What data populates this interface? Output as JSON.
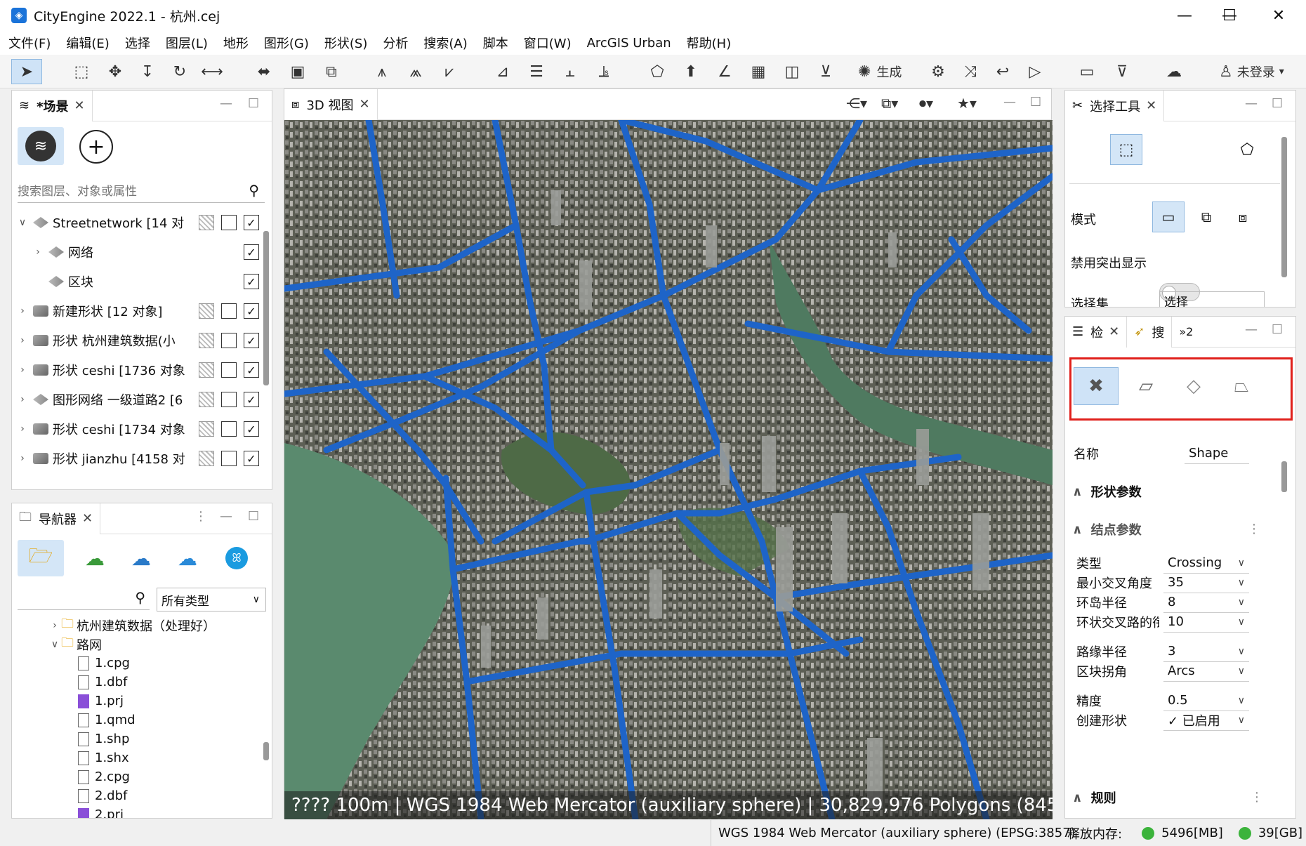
{
  "window": {
    "title": "CityEngine 2022.1 - 杭州.cej",
    "minimize": "—",
    "maximize": "☐",
    "close": "✕"
  },
  "menu": [
    "文件(F)",
    "编辑(E)",
    "选择",
    "图层(L)",
    "地形",
    "图形(G)",
    "形状(S)",
    "分析",
    "搜索(A)",
    "脚本",
    "窗口(W)",
    "ArcGIS Urban",
    "帮助(H)"
  ],
  "toolbar": {
    "generate_label": "生成",
    "login_label": "未登录",
    "login_caret": "▾"
  },
  "scene_panel": {
    "tab_label": "*场景",
    "search_placeholder": "搜索图层、对象或属性",
    "layers": [
      {
        "caret": "∨",
        "name": "Streetnetwork [14 对",
        "hatch": true,
        "box": true,
        "checked": true
      },
      {
        "caret": "›",
        "name": "网络",
        "hatch": false,
        "box": false,
        "checked": true
      },
      {
        "caret": "",
        "name": "区块",
        "hatch": false,
        "box": false,
        "checked": true
      },
      {
        "caret": "›",
        "name": "新建形状 [12 对象]",
        "hatch": true,
        "box": true,
        "checked": true
      },
      {
        "caret": "›",
        "name": "形状 杭州建筑数据(小",
        "hatch": true,
        "box": true,
        "checked": true
      },
      {
        "caret": "›",
        "name": "形状 ceshi [1736 对象",
        "hatch": true,
        "box": true,
        "checked": true
      },
      {
        "caret": "›",
        "name": "图形网络 一级道路2 [6",
        "hatch": true,
        "box": true,
        "checked": true
      },
      {
        "caret": "›",
        "name": "形状 ceshi [1734 对象",
        "hatch": true,
        "box": true,
        "checked": true
      },
      {
        "caret": "›",
        "name": "形状 jianzhu [4158 对",
        "hatch": true,
        "box": true,
        "checked": true
      }
    ],
    "check_mark": "✓"
  },
  "navigator_panel": {
    "tab_label": "导航器",
    "filter_value": "所有类型",
    "tree": [
      {
        "indent": 1,
        "caret": "›",
        "type": "folder",
        "name": "杭州建筑数据（处理好）"
      },
      {
        "indent": 1,
        "caret": "∨",
        "type": "folder",
        "name": "路网"
      },
      {
        "indent": 2,
        "caret": "",
        "type": "file",
        "name": "1.cpg"
      },
      {
        "indent": 2,
        "caret": "",
        "type": "file",
        "name": "1.dbf"
      },
      {
        "indent": 2,
        "caret": "",
        "type": "prj",
        "name": "1.prj"
      },
      {
        "indent": 2,
        "caret": "",
        "type": "file",
        "name": "1.qmd"
      },
      {
        "indent": 2,
        "caret": "",
        "type": "file",
        "name": "1.shp"
      },
      {
        "indent": 2,
        "caret": "",
        "type": "file",
        "name": "1.shx"
      },
      {
        "indent": 2,
        "caret": "",
        "type": "file",
        "name": "2.cpg"
      },
      {
        "indent": 2,
        "caret": "",
        "type": "file",
        "name": "2.dbf"
      },
      {
        "indent": 2,
        "caret": "",
        "type": "prj",
        "name": "2.prj"
      }
    ]
  },
  "viewport": {
    "tab_label": "3D 视图",
    "status_text": "???? 100m  |  WGS 1984 Web Mercator (auxiliary sphere)  |  30,829,976 Polygons  (845,"
  },
  "select_tool_panel": {
    "tab_label": "选择工具",
    "mode_label": "模式",
    "highlight_label": "禁用突出显示",
    "selection_set_label": "选择集",
    "selection_set_value": "选择"
  },
  "inspector": {
    "tab_label": "检",
    "search_tab_label": "搜",
    "overflow_label": "»2",
    "name_label": "名称",
    "name_value": "Shape",
    "section_shape": "形状参数",
    "section_node": "结点参数",
    "section_rules": "规则",
    "params": [
      {
        "label": "类型",
        "value": "Crossing"
      },
      {
        "label": "最小交叉角度",
        "value": "35"
      },
      {
        "label": "环岛半径",
        "value": "8"
      },
      {
        "label": "环状交叉路的衔",
        "value": "10"
      },
      {
        "label": "路缘半径",
        "value": "3"
      },
      {
        "label": "区块拐角",
        "value": "Arcs"
      },
      {
        "label": "精度",
        "value": "0.5"
      },
      {
        "label": "创建形状",
        "value": "✓ 已启用"
      }
    ],
    "highlight_color": "#e0201b"
  },
  "statusbar": {
    "crs": "WGS 1984 Web Mercator (auxiliary sphere) (EPSG:3857)",
    "mem_label": "释放内存:",
    "mem1": "5496[MB]",
    "mem2": "39[GB]"
  }
}
